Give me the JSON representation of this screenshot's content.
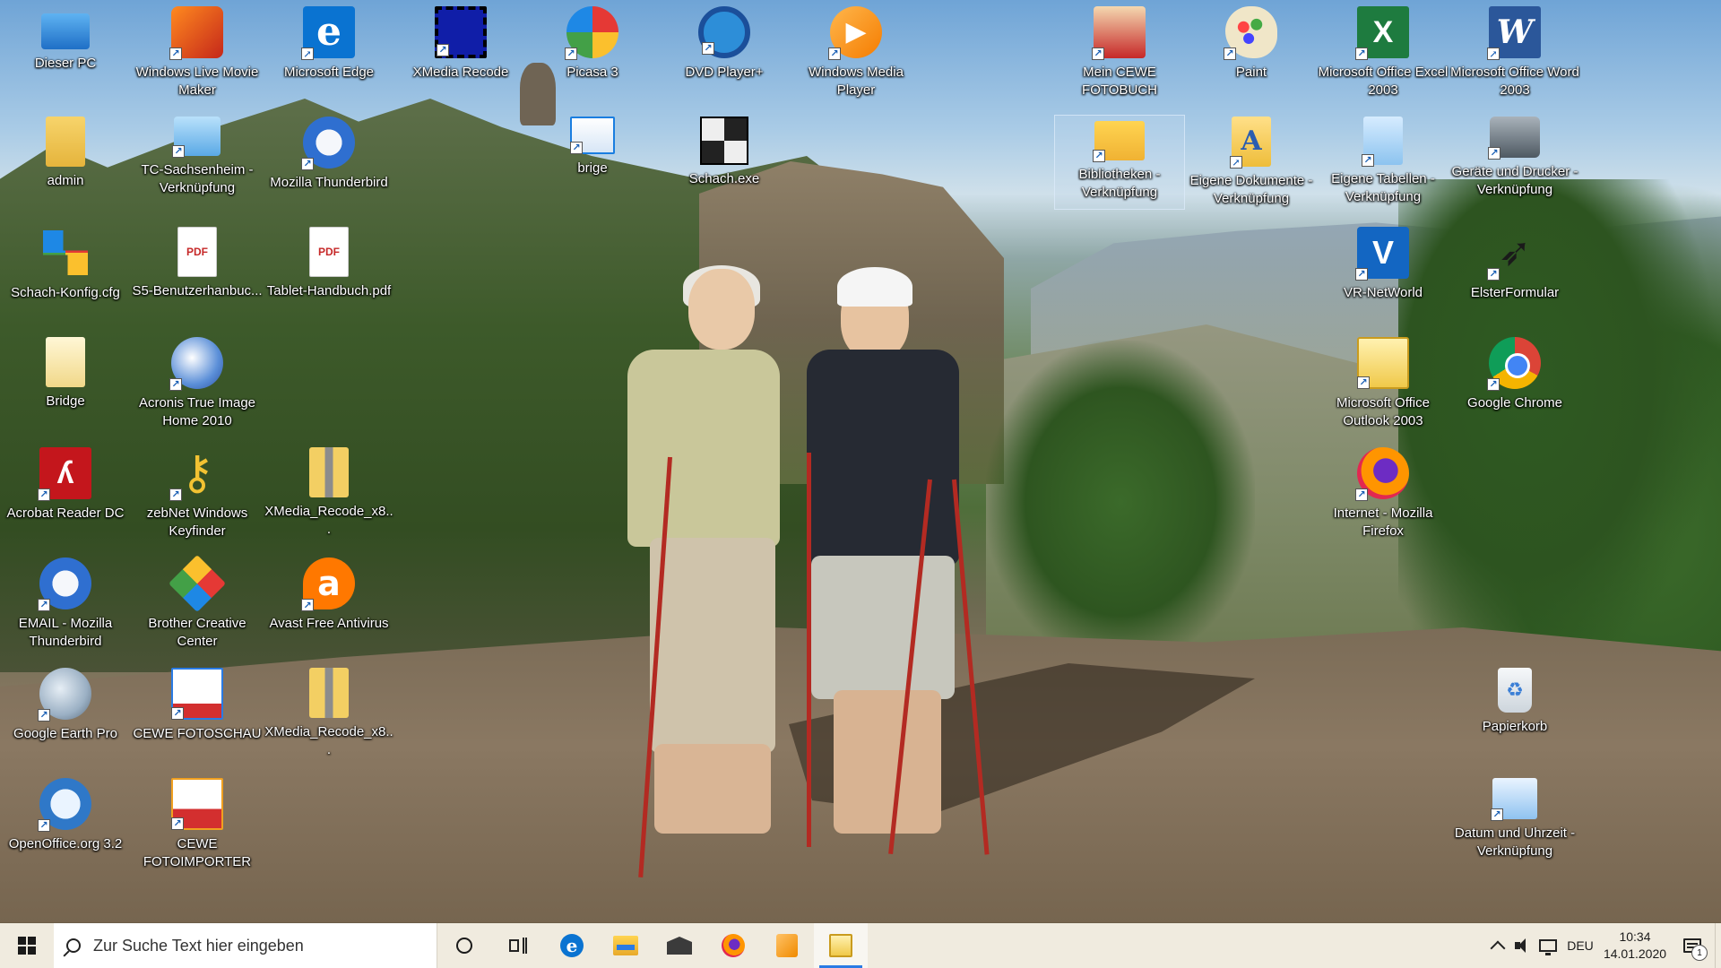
{
  "desktop": {
    "icons": [
      {
        "label": "Dieser PC",
        "icon": "computer-icon"
      },
      {
        "label": "Windows Live Movie Maker",
        "icon": "movie-maker-icon"
      },
      {
        "label": "Microsoft Edge",
        "icon": "edge-icon"
      },
      {
        "label": "XMedia Recode",
        "icon": "film-strip-icon"
      },
      {
        "label": "Picasa 3",
        "icon": "picasa-icon"
      },
      {
        "label": "DVD Player+",
        "icon": "dvd-player-icon"
      },
      {
        "label": "Windows Media Player",
        "icon": "media-player-icon"
      },
      {
        "label": "Mein CEWE FOTOBUCH",
        "icon": "cewe-photobook-icon"
      },
      {
        "label": "Paint",
        "icon": "paint-palette-icon"
      },
      {
        "label": "Microsoft Office Excel 2003",
        "icon": "excel-icon"
      },
      {
        "label": "Microsoft Office Word 2003",
        "icon": "word-icon"
      },
      {
        "label": "admin",
        "icon": "user-folder-icon"
      },
      {
        "label": "TC-Sachsenheim - Verknüpfung",
        "icon": "network-computer-icon"
      },
      {
        "label": "Mozilla Thunderbird",
        "icon": "thunderbird-icon"
      },
      {
        "label": "brige",
        "icon": "window-app-icon"
      },
      {
        "label": "Schach.exe",
        "icon": "chess-board-icon"
      },
      {
        "label": "Bibliotheken - Verknüpfung",
        "icon": "libraries-folder-icon"
      },
      {
        "label": "Eigene Dokumente - Verknüpfung",
        "icon": "documents-folder-icon"
      },
      {
        "label": "Eigene Tabellen - Verknüpfung",
        "icon": "tables-icon"
      },
      {
        "label": "Geräte und Drucker - Verknüpfung",
        "icon": "printer-icon"
      },
      {
        "label": "Schach-Konfig.cfg",
        "icon": "config-file-icon"
      },
      {
        "label": "S5-Benutzerhanbuc...",
        "icon": "pdf-file-icon"
      },
      {
        "label": "Tablet-Handbuch.pdf",
        "icon": "pdf-file-icon"
      },
      {
        "label": "VR-NetWorld",
        "icon": "vr-networld-icon"
      },
      {
        "label": "ElsterFormular",
        "icon": "elster-magpie-icon"
      },
      {
        "label": "Bridge",
        "icon": "plain-folder-icon"
      },
      {
        "label": "Acronis True Image Home 2010",
        "icon": "acronis-icon"
      },
      {
        "label": "Microsoft Office Outlook 2003",
        "icon": "outlook-icon"
      },
      {
        "label": "Google Chrome",
        "icon": "chrome-icon"
      },
      {
        "label": "Acrobat Reader DC",
        "icon": "acrobat-icon"
      },
      {
        "label": "zebNet Windows Keyfinder",
        "icon": "key-icon"
      },
      {
        "label": "XMedia_Recode_x8...",
        "icon": "zip-folder-icon"
      },
      {
        "label": "Internet - Mozilla Firefox",
        "icon": "firefox-icon"
      },
      {
        "label": "EMAIL - Mozilla Thunderbird",
        "icon": "thunderbird-icon"
      },
      {
        "label": "Brother Creative Center",
        "icon": "brother-creative-icon"
      },
      {
        "label": "Avast Free Antivirus",
        "icon": "avast-icon"
      },
      {
        "label": "Google Earth Pro",
        "icon": "google-earth-icon"
      },
      {
        "label": "CEWE FOTOSCHAU",
        "icon": "cewe-fotoschau-icon"
      },
      {
        "label": "XMedia_Recode_x8...",
        "icon": "zip-folder-icon"
      },
      {
        "label": "Papierkorb",
        "icon": "recycle-bin-icon"
      },
      {
        "label": "OpenOffice.org 3.2",
        "icon": "openoffice-icon"
      },
      {
        "label": "CEWE FOTOIMPORTER",
        "icon": "cewe-importer-icon"
      },
      {
        "label": "Datum und Uhrzeit - Verknüpfung",
        "icon": "date-time-icon"
      }
    ]
  },
  "taskbar": {
    "search_placeholder": "Zur Suche Text hier eingeben",
    "pinned": [
      "edge-icon",
      "file-explorer-icon",
      "mail-icon",
      "firefox-icon",
      "media-player-icon",
      "outlook-icon"
    ],
    "active_app": "outlook-icon",
    "language": "DEU",
    "time": "10:34",
    "date": "14.01.2020",
    "notification_count": "1",
    "accent_color": "#2a7be4",
    "background_color": "#f0ebdf"
  }
}
